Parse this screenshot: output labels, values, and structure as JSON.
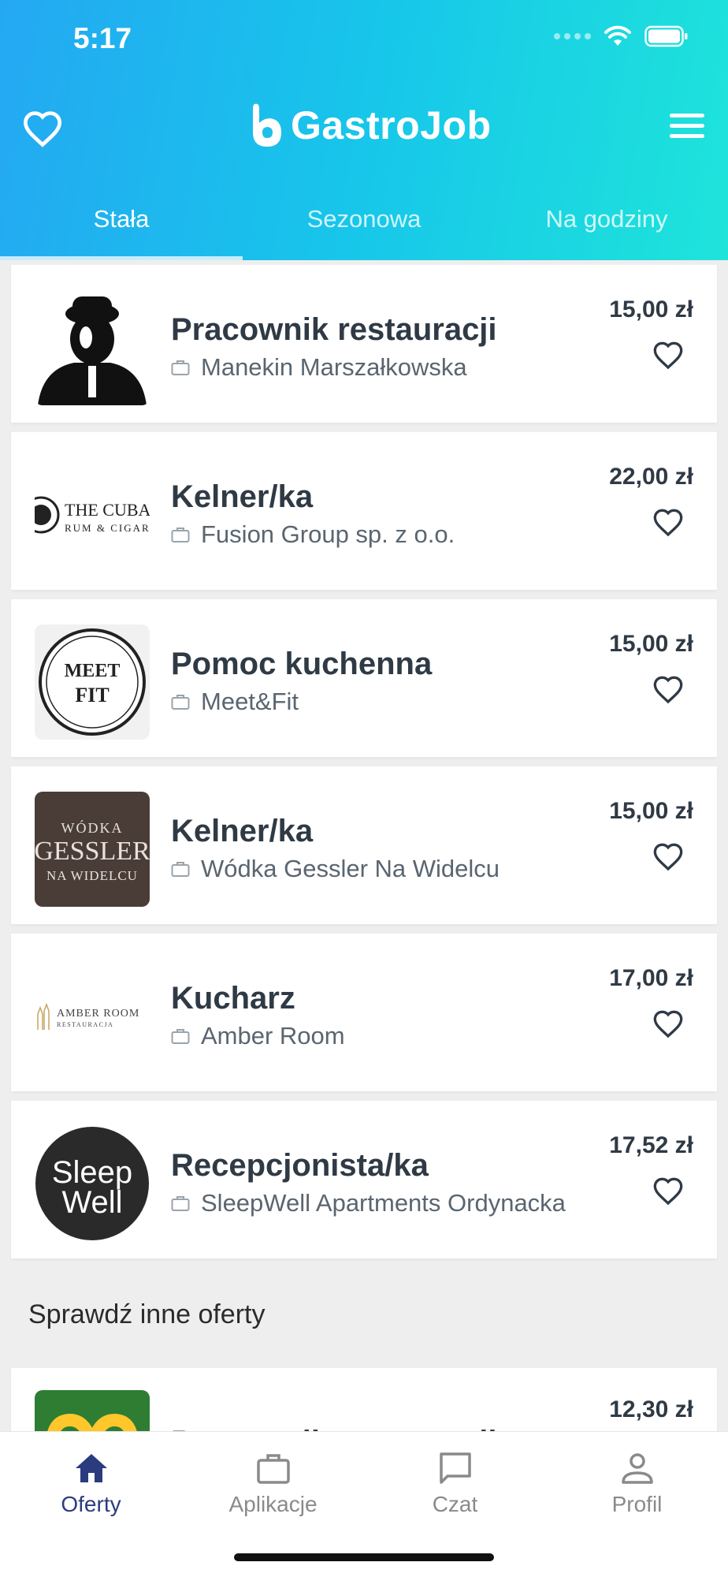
{
  "status_bar": {
    "time": "5:17"
  },
  "header": {
    "logo_text": "GastroJob",
    "tabs": [
      {
        "label": "Stała",
        "active": true
      },
      {
        "label": "Sezonowa",
        "active": false
      },
      {
        "label": "Na godziny",
        "active": false
      }
    ]
  },
  "jobs": [
    {
      "title": "Pracownik restauracji",
      "company": "Manekin Marszałkowska",
      "price": "15,00 zł",
      "logo": "manekin-logo"
    },
    {
      "title": "Kelner/ka",
      "company": "Fusion Group sp. z o.o.",
      "price": "22,00 zł",
      "logo": "the-cuba-logo",
      "logo_text": "THE CUBA",
      "logo_subtext": "RUM & CIGAR"
    },
    {
      "title": "Pomoc kuchenna",
      "company": "Meet&Fit",
      "price": "15,00 zł",
      "logo": "meet-fit-logo",
      "logo_text": "MEET",
      "logo_subtext": "FIT"
    },
    {
      "title": "Kelner/ka",
      "company": "Wódka Gessler Na Widelcu",
      "price": "15,00 zł",
      "logo": "gessler-logo",
      "logo_text_top": "WÓDKA",
      "logo_text": "GESSLER",
      "logo_subtext": "NA WIDELCU"
    },
    {
      "title": "Kucharz",
      "company": "Amber Room",
      "price": "17,00 zł",
      "logo": "amber-room-logo",
      "logo_text": "AMBER ROOM",
      "logo_subtext": "RESTAURACJA"
    },
    {
      "title": "Recepcjonista/ka",
      "company": "SleepWell Apartments Ordynacka",
      "price": "17,52 zł",
      "logo": "sleepwell-logo",
      "logo_text": "Sleep",
      "logo_subtext": "Well"
    }
  ],
  "other_section": {
    "title": "Sprawdź inne oferty",
    "first_job": {
      "title": "Pracownik restauracji",
      "price": "12,30 zł",
      "logo": "mcdonalds-logo"
    }
  },
  "bottom_nav": [
    {
      "label": "Oferty",
      "icon": "home-icon",
      "active": true
    },
    {
      "label": "Aplikacje",
      "icon": "briefcase-icon",
      "active": false
    },
    {
      "label": "Czat",
      "icon": "chat-icon",
      "active": false
    },
    {
      "label": "Profil",
      "icon": "profile-icon",
      "active": false
    }
  ],
  "colors": {
    "header_gradient_start": "#24a8f2",
    "header_gradient_end": "#1ee4da",
    "nav_active": "#2b3c7e",
    "nav_inactive": "#8a8a8a"
  }
}
